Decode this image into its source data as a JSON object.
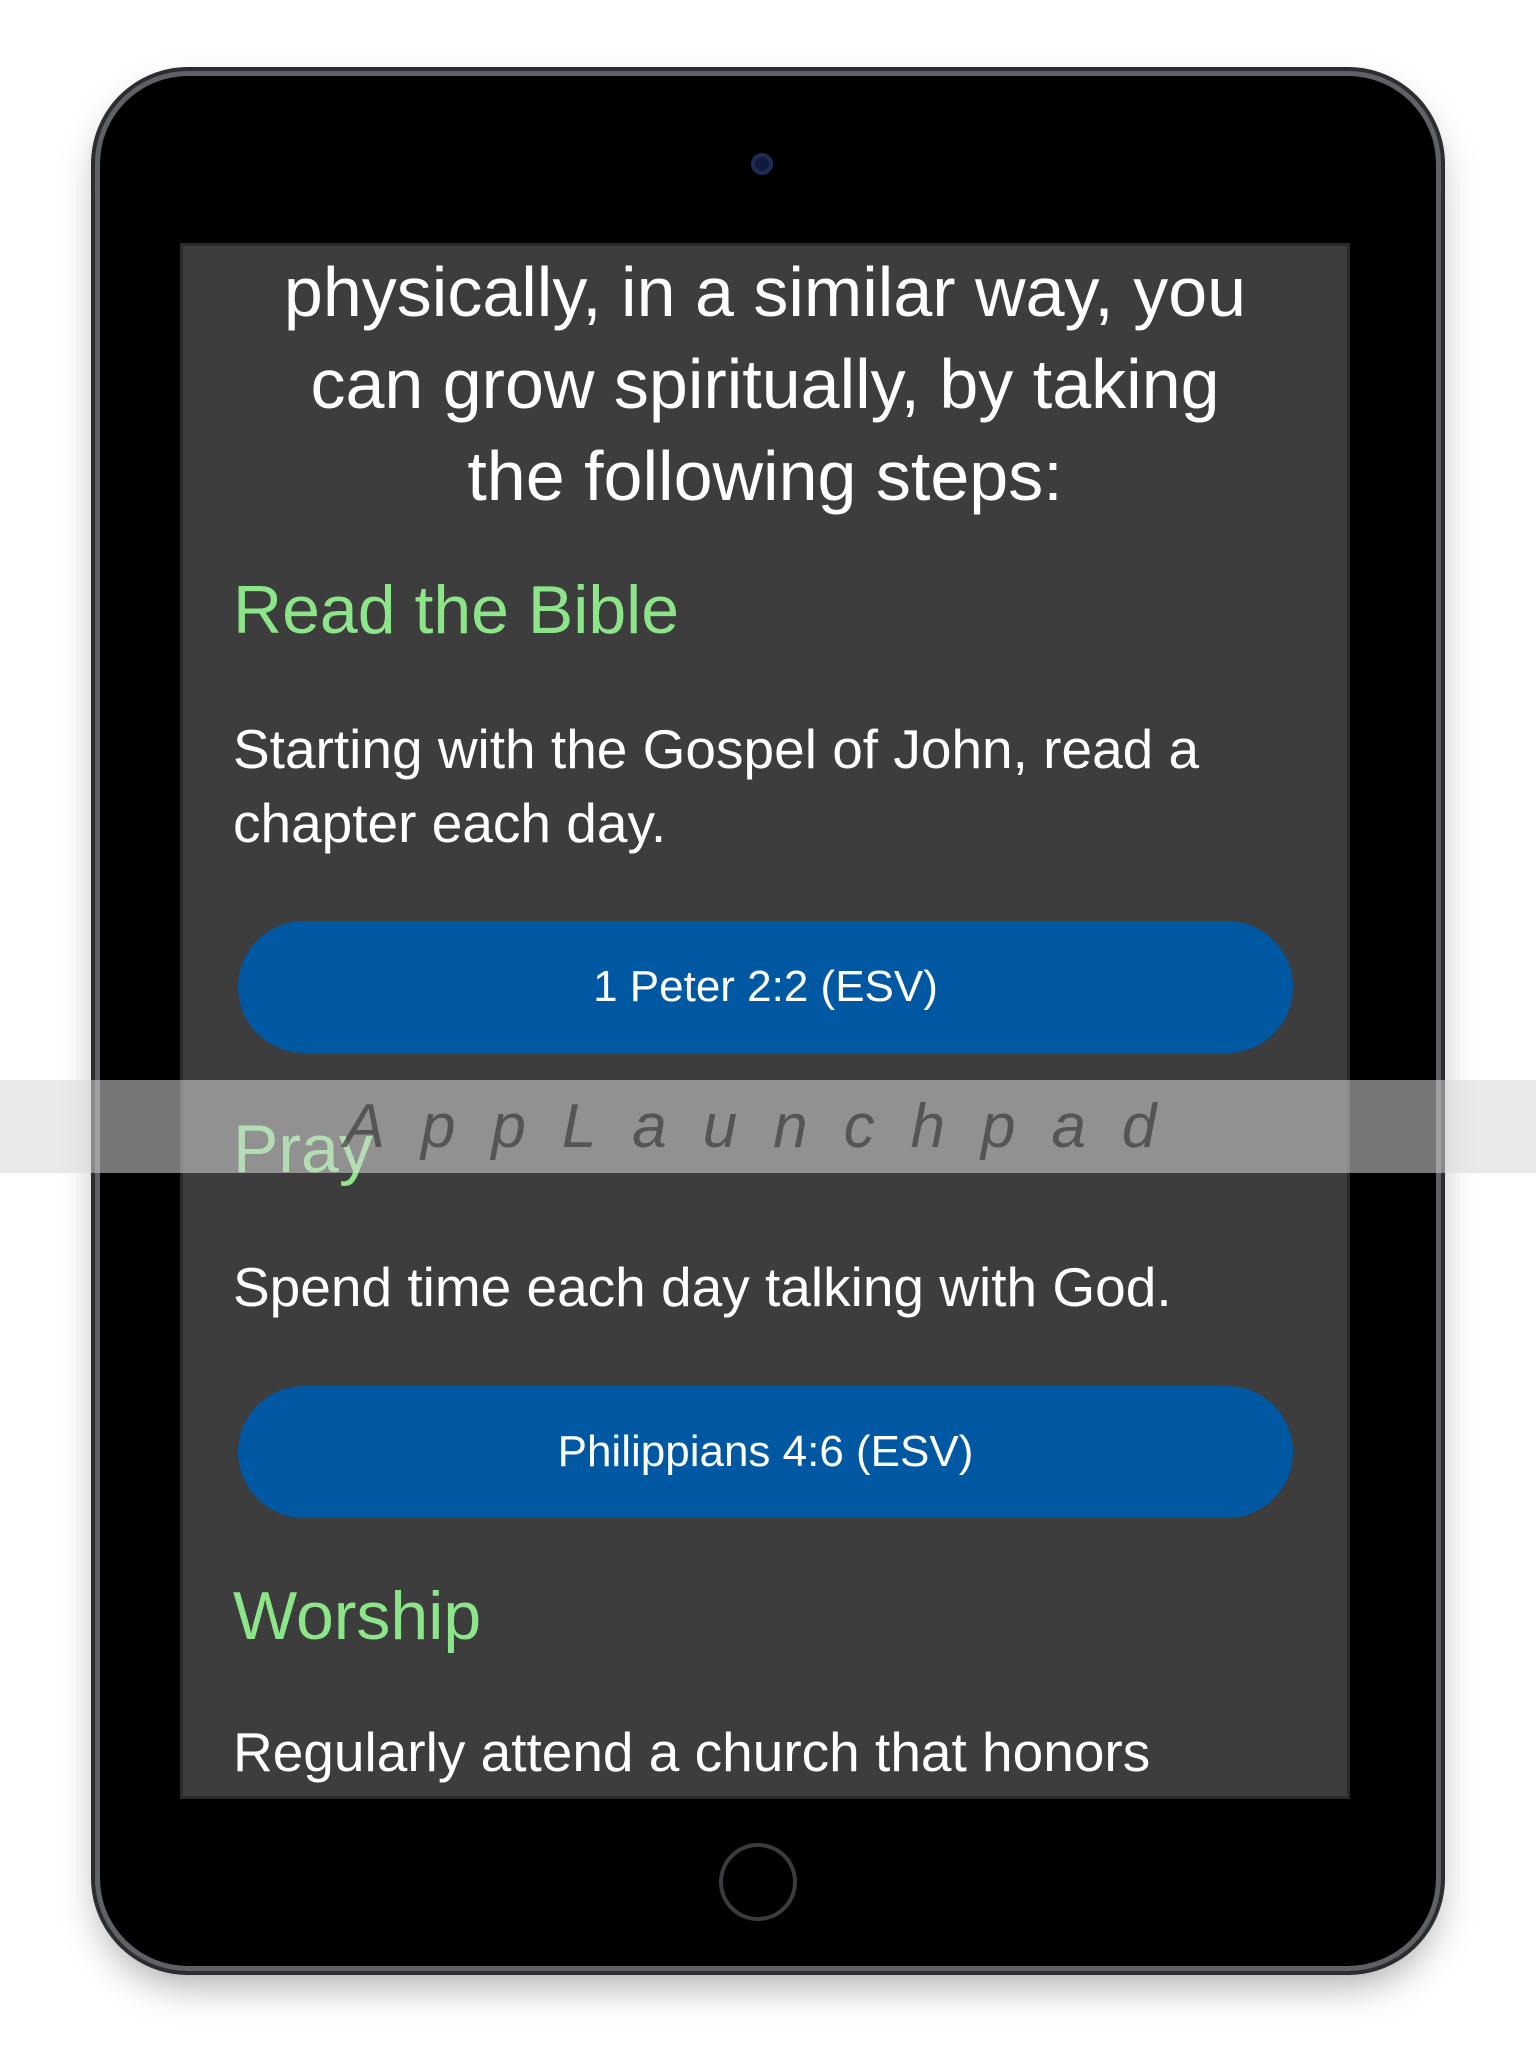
{
  "intro": {
    "lines": [
      "physically, in a similar way, you",
      "can grow spiritually, by taking",
      "the following steps:"
    ]
  },
  "sections": [
    {
      "heading": "Read the Bible",
      "body": [
        "Starting with the Gospel of John, read a",
        "chapter each day."
      ],
      "button": "1 Peter 2:2 (ESV)"
    },
    {
      "heading": "Pray",
      "body": [
        "Spend time each day talking with God."
      ],
      "button": "Philippians 4:6 (ESV)"
    },
    {
      "heading": "Worship",
      "body": [
        "Regularly attend a church that honors"
      ]
    }
  ],
  "watermark": "AppLaunchpad",
  "colors": {
    "heading": "#8de58a",
    "button": "#0058a3",
    "background": "#3d3d3d"
  }
}
